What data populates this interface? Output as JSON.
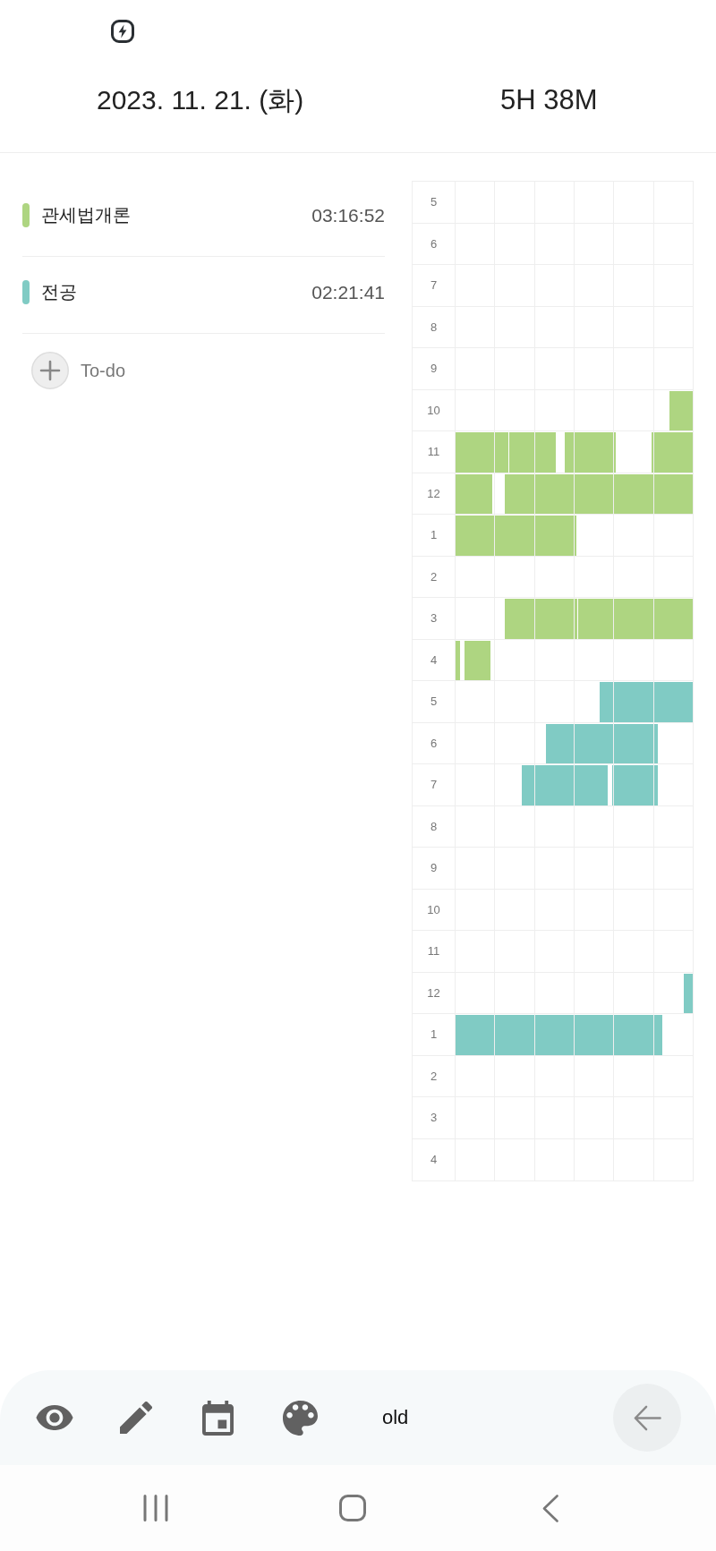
{
  "header": {
    "date": "2023. 11. 21. (화)",
    "total": "5H 38M"
  },
  "subjects": [
    {
      "name": "관세법개론",
      "time": "03:16:52",
      "color": "#aed581"
    },
    {
      "name": "전공",
      "time": "02:21:41",
      "color": "#80cbc4"
    }
  ],
  "todo": {
    "label": "To-do"
  },
  "timetable": {
    "rows": [
      {
        "hour": "5"
      },
      {
        "hour": "6"
      },
      {
        "hour": "7"
      },
      {
        "hour": "8"
      },
      {
        "hour": "9"
      },
      {
        "hour": "10"
      },
      {
        "hour": "11"
      },
      {
        "hour": "12"
      },
      {
        "hour": "1"
      },
      {
        "hour": "2"
      },
      {
        "hour": "3"
      },
      {
        "hour": "4"
      },
      {
        "hour": "5"
      },
      {
        "hour": "6"
      },
      {
        "hour": "7"
      },
      {
        "hour": "8"
      },
      {
        "hour": "9"
      },
      {
        "hour": "10"
      },
      {
        "hour": "11"
      },
      {
        "hour": "12"
      },
      {
        "hour": "1"
      },
      {
        "hour": "2"
      },
      {
        "hour": "3"
      },
      {
        "hour": "4"
      }
    ]
  },
  "toolbar": {
    "label": "old"
  }
}
